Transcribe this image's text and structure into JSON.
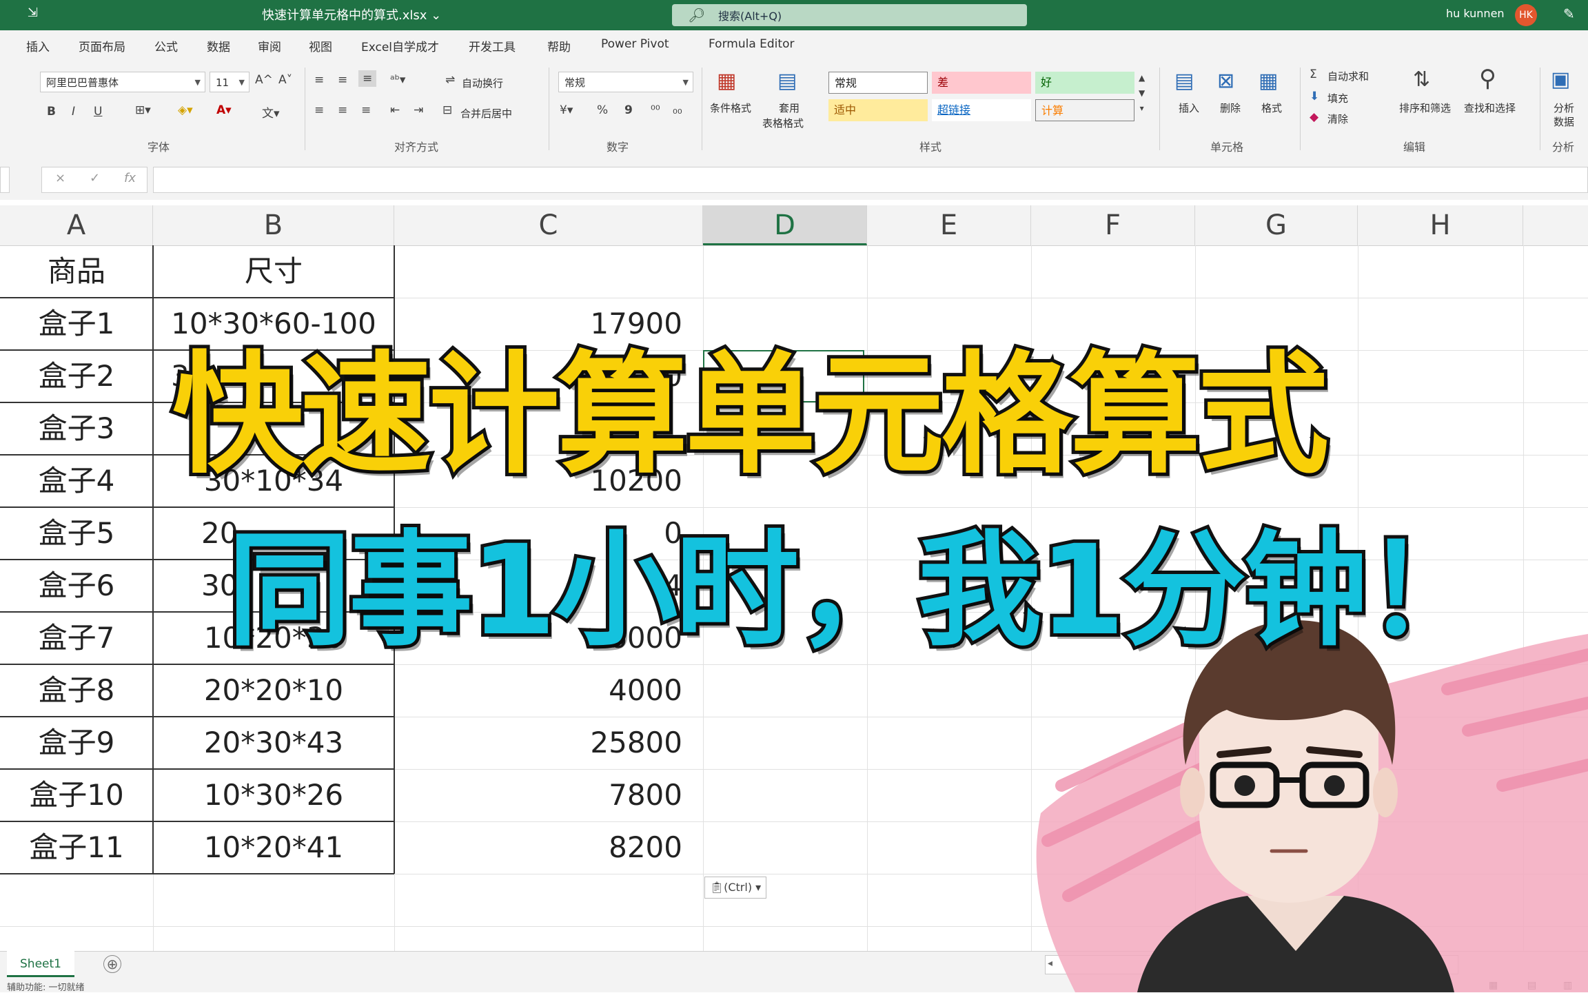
{
  "app": {
    "title": "快速计算单元格中的算式.xlsx ⌄",
    "quick_access": "⇲",
    "search_placeholder": "搜索(Alt+Q)",
    "user_name": "hu kunnen",
    "user_initials": "HK"
  },
  "ribbon_tabs": [
    "插入",
    "页面布局",
    "公式",
    "数据",
    "审阅",
    "视图",
    "Excel自学成才",
    "开发工具",
    "帮助",
    "Power Pivot",
    "Formula Editor"
  ],
  "ribbon": {
    "font": {
      "font_name": "阿里巴巴普惠体",
      "font_size": "11",
      "grow": "A^",
      "shrink": "A˅",
      "bold": "B",
      "italic": "I",
      "underline": "U",
      "label": "字体"
    },
    "alignment": {
      "wrap_text": "自动换行",
      "merge_center": "合并后居中",
      "label": "对齐方式"
    },
    "number": {
      "format": "常规",
      "percent": "%",
      "comma": "9",
      "label": "数字"
    },
    "styles": {
      "conditional_format": "条件格式",
      "format_as_table_1": "套用",
      "format_as_table_2": "表格格式",
      "cells": [
        {
          "text": "常规",
          "bg": "#ffffff",
          "color": "#222222"
        },
        {
          "text": "差",
          "bg": "#ffc7ce",
          "color": "#9c0006"
        },
        {
          "text": "好",
          "bg": "#c6efce",
          "color": "#006100"
        },
        {
          "text": "适中",
          "bg": "#ffeb9c",
          "color": "#9c5700"
        },
        {
          "text": "超链接",
          "bg": "#ffffff",
          "color": "#0563c1"
        },
        {
          "text": "计算",
          "bg": "#f2f2f2",
          "color": "#fa7d00"
        }
      ],
      "label": "样式"
    },
    "cells_group": {
      "insert": "插入",
      "delete": "删除",
      "format": "格式",
      "label": "单元格"
    },
    "editing": {
      "autosum": "自动求和",
      "fill": "填充",
      "clear": "清除",
      "sort_filter": "排序和筛选",
      "find_select": "查找和选择",
      "label": "编辑"
    },
    "analysis": {
      "analyze_1": "分析",
      "analyze_2": "数据",
      "label": "分析"
    }
  },
  "formula_bar": {
    "cancel": "×",
    "enter": "✓",
    "fx": "fx"
  },
  "columns": [
    "A",
    "B",
    "C",
    "D",
    "E",
    "F",
    "G",
    "H"
  ],
  "selected_column": "D",
  "table": {
    "headers": [
      "商品",
      "尺寸"
    ],
    "rows": [
      {
        "a": "盒子1",
        "b": "10*30*60-100",
        "c": "17900"
      },
      {
        "a": "盒子2",
        "b": "3",
        "c": "0"
      },
      {
        "a": "盒子3",
        "b": "*",
        "c": ""
      },
      {
        "a": "盒子4",
        "b": "30*10*34",
        "c": "10200"
      },
      {
        "a": "盒子5",
        "b": "20",
        "c": "0"
      },
      {
        "a": "盒子6",
        "b": "30",
        "c": "4"
      },
      {
        "a": "盒子7",
        "b": "10*20*30",
        "c": "6000"
      },
      {
        "a": "盒子8",
        "b": "20*20*10",
        "c": "4000"
      },
      {
        "a": "盒子9",
        "b": "20*30*43",
        "c": "25800"
      },
      {
        "a": "盒子10",
        "b": "10*30*26",
        "c": "7800"
      },
      {
        "a": "盒子11",
        "b": "10*20*41",
        "c": "8200"
      }
    ]
  },
  "paste_options": "(Ctrl) ▾",
  "sheet_tabs": [
    "Sheet1"
  ],
  "add_sheet": "⊕",
  "status": "辅助功能: 一切就绪",
  "overlay": {
    "line1": "快速计算单元格算式",
    "line2": "同事1小时，我1分钟！"
  },
  "colors": {
    "excel_green": "#1f7244",
    "headline_yellow": "#f9d008",
    "headline_cyan": "#14c2de",
    "splash_pink": "#f3a9be"
  }
}
